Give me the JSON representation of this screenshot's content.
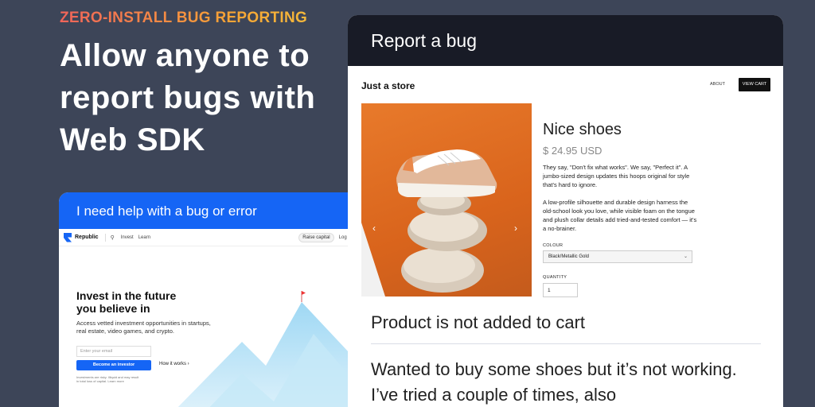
{
  "hero": {
    "eyebrow": "ZERO-INSTALL BUG REPORTING",
    "headline": "Allow anyone to report bugs with Web SDK"
  },
  "help_card": {
    "header": "I need help with a bug or error",
    "site": {
      "brand": "Republic",
      "nav_links": [
        "Invest",
        "Learn"
      ],
      "raise_capital": "Raise capital",
      "login": "Log in",
      "title": "Invest in the future you believe in",
      "subtitle": "Access vetted investment opportunities in startups, real estate, video games, and crypto.",
      "email_placeholder": "Enter your email",
      "cta": "Become an investor",
      "how_it_works": "How it works ›",
      "disclaimer": "Investments are risky. Illiquid and may result in total loss of capital. Learn more"
    }
  },
  "bug_card": {
    "header": "Report a bug",
    "store": {
      "name": "Just a store",
      "about": "ABOUT",
      "view_cart": "VIEW CART",
      "product_title": "Nice shoes",
      "price": "$ 24.95 USD",
      "description_1": "They say, \"Don't fix what works\". We say, \"Perfect it\". A jumbo-sized design updates this hoops original for style that's hard to ignore.",
      "description_2": "A low-profile silhouette and durable design harness the old-school look you love, while visible foam on the tongue and plush collar details add tried-and-tested comfort — it's a no-brainer.",
      "colour_label": "COLOUR",
      "colour_value": "Black/Metallic Gold",
      "quantity_label": "QUANTITY",
      "quantity_value": "1"
    },
    "report_title": "Product is not added to cart",
    "report_description": "Wanted to buy some shoes but it’s not working. I’ve tried a couple of times, also"
  },
  "colors": {
    "background": "#3d4558",
    "republic_blue": "#1565f5",
    "bug_header": "#181b26",
    "product_orange": "#e87a2b"
  }
}
